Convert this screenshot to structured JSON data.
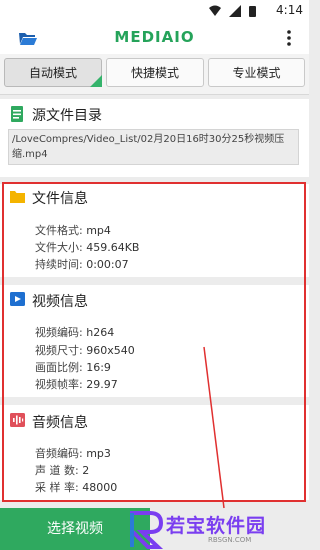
{
  "app": {
    "title": "MEDIAIO"
  },
  "status": {
    "time": "4:14"
  },
  "tabs": [
    {
      "label": "自动模式",
      "active": true
    },
    {
      "label": "快捷模式",
      "active": false
    },
    {
      "label": "专业模式",
      "active": false
    }
  ],
  "source": {
    "title": "源文件目录",
    "path_line1": "/LoveCompres/Video_List/02月20日16时30分25秒视频压",
    "path_line2": "缩.mp4"
  },
  "file_info": {
    "title": "文件信息",
    "rows": [
      {
        "label": "文件格式:",
        "value": "mp4"
      },
      {
        "label": "文件大小:",
        "value": "459.64KB"
      },
      {
        "label": "持续时间:",
        "value": "0:00:07"
      }
    ]
  },
  "video_info": {
    "title": "视频信息",
    "rows": [
      {
        "label": "视频编码:",
        "value": "h264"
      },
      {
        "label": "视频尺寸:",
        "value": "960x540"
      },
      {
        "label": "画面比例:",
        "value": "16:9"
      },
      {
        "label": "视频帧率:",
        "value": "29.97"
      }
    ]
  },
  "audio_info": {
    "title": "音频信息",
    "rows": [
      {
        "label": "音频编码:",
        "value": "mp3"
      },
      {
        "label": "声 道 数:",
        "value": "2"
      },
      {
        "label": "采 样 率:",
        "value": "48000"
      }
    ]
  },
  "bottom": {
    "select_label": "选择视频"
  },
  "watermark": {
    "text": "若宝软件园",
    "site": "RBSGN.COM"
  },
  "colors": {
    "accent": "#2fa95f",
    "highlight": "#e03030"
  }
}
